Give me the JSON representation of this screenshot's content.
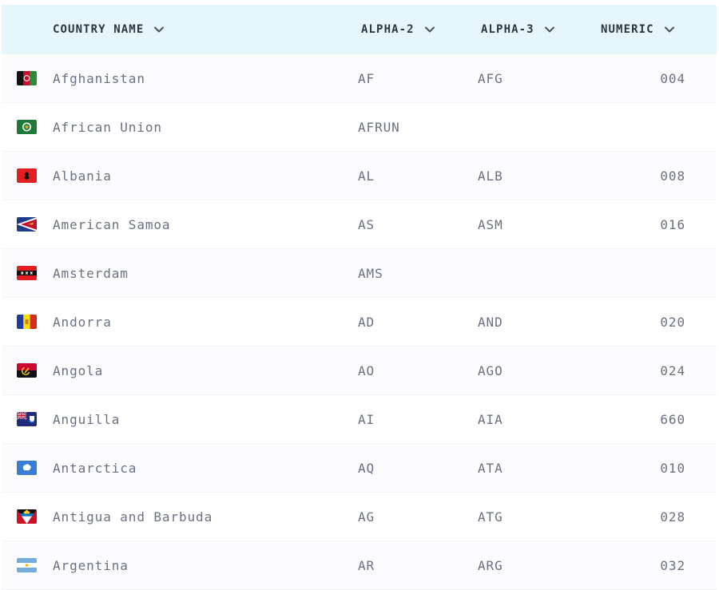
{
  "header": {
    "name_label": "COUNTRY NAME",
    "alpha2_label": "ALPHA-2",
    "alpha3_label": "ALPHA-3",
    "numeric_label": "NUMERIC"
  },
  "rows": [
    {
      "name": "Afghanistan",
      "alpha2": "AF",
      "alpha3": "AFG",
      "numeric": "004",
      "flag_icon": "afghanistan-flag-icon"
    },
    {
      "name": "African Union",
      "alpha2": "AFRUN",
      "alpha3": "",
      "numeric": "",
      "flag_icon": "african-union-flag-icon"
    },
    {
      "name": "Albania",
      "alpha2": "AL",
      "alpha3": "ALB",
      "numeric": "008",
      "flag_icon": "albania-flag-icon"
    },
    {
      "name": "American Samoa",
      "alpha2": "AS",
      "alpha3": "ASM",
      "numeric": "016",
      "flag_icon": "american-samoa-flag-icon"
    },
    {
      "name": "Amsterdam",
      "alpha2": "AMS",
      "alpha3": "",
      "numeric": "",
      "flag_icon": "amsterdam-flag-icon"
    },
    {
      "name": "Andorra",
      "alpha2": "AD",
      "alpha3": "AND",
      "numeric": "020",
      "flag_icon": "andorra-flag-icon"
    },
    {
      "name": "Angola",
      "alpha2": "AO",
      "alpha3": "AGO",
      "numeric": "024",
      "flag_icon": "angola-flag-icon"
    },
    {
      "name": "Anguilla",
      "alpha2": "AI",
      "alpha3": "AIA",
      "numeric": "660",
      "flag_icon": "anguilla-flag-icon"
    },
    {
      "name": "Antarctica",
      "alpha2": "AQ",
      "alpha3": "ATA",
      "numeric": "010",
      "flag_icon": "antarctica-flag-icon"
    },
    {
      "name": "Antigua and Barbuda",
      "alpha2": "AG",
      "alpha3": "ATG",
      "numeric": "028",
      "flag_icon": "antigua-and-barbuda-flag-icon"
    },
    {
      "name": "Argentina",
      "alpha2": "AR",
      "alpha3": "ARG",
      "numeric": "032",
      "flag_icon": "argentina-flag-icon"
    }
  ],
  "colors": {
    "header_bg": "#e6f7fc",
    "header_text": "#2d3540",
    "cell_text": "#6b7180",
    "row_bg": "#fcfcff"
  }
}
